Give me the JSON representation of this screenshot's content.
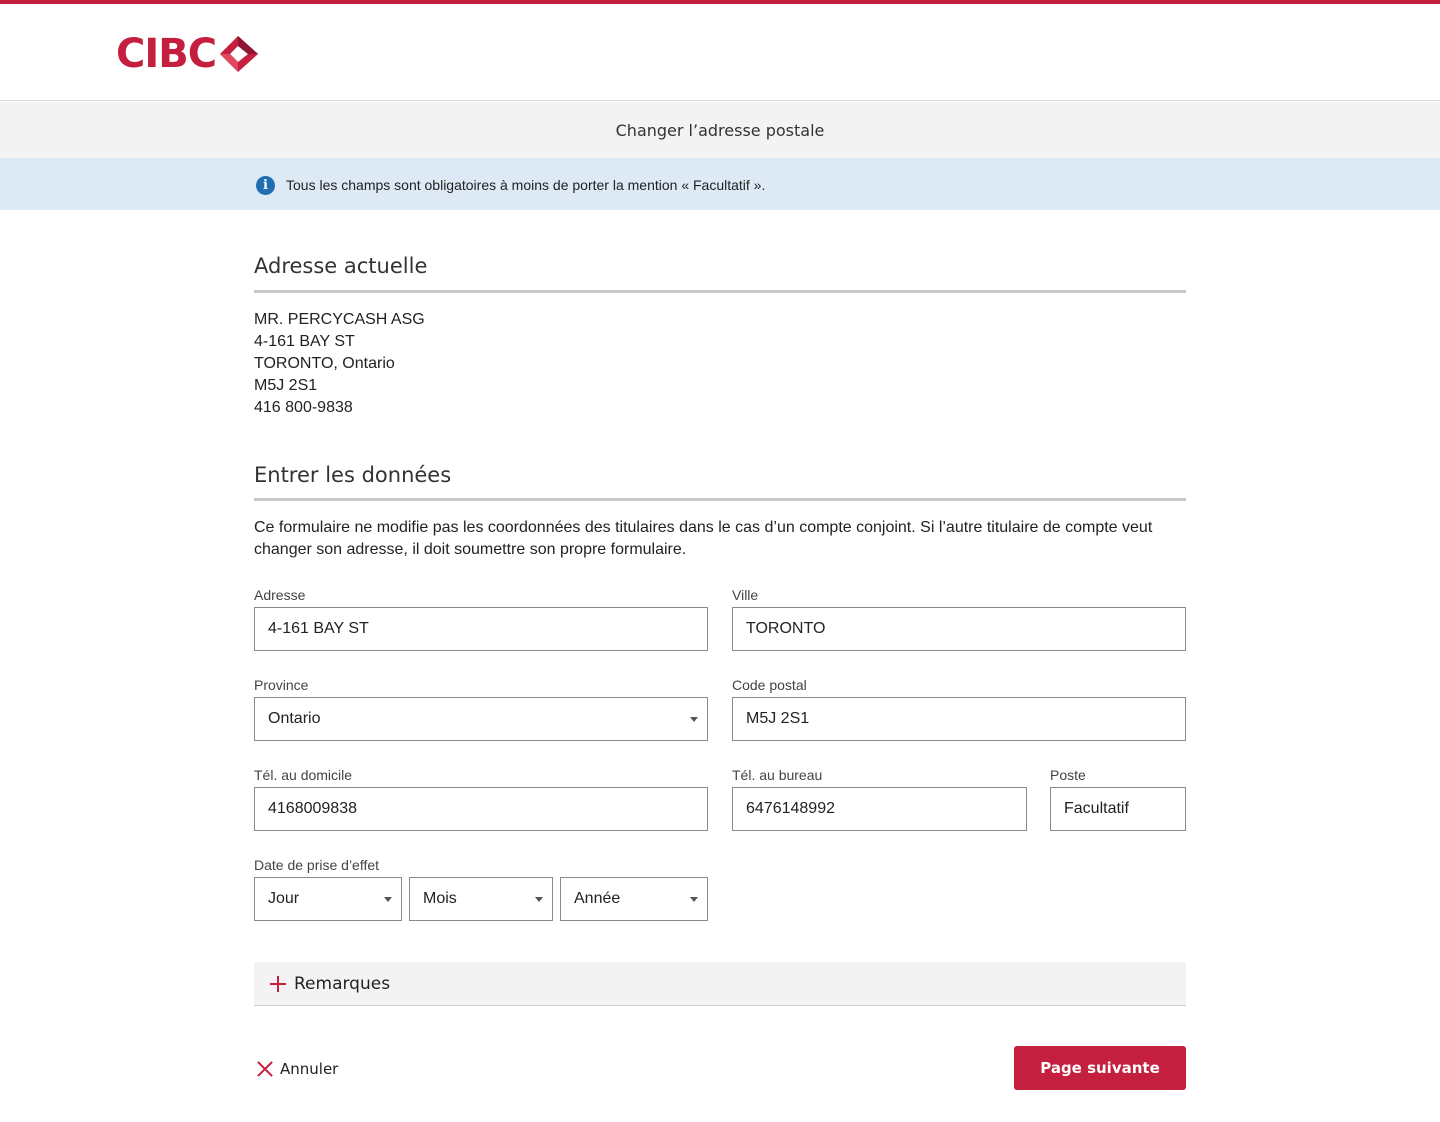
{
  "brand": {
    "name": "CIBC",
    "color": "#c41f3e"
  },
  "page": {
    "title": "Changer l’adresse postale"
  },
  "info": {
    "icon": "info-icon",
    "text": "Tous les champs sont obligatoires à moins de porter la mention « Facultatif »."
  },
  "current_address": {
    "heading": "Adresse actuelle",
    "lines": [
      "MR. PERCYCASH ASG",
      "4-161 BAY ST",
      "TORONTO, Ontario",
      "M5J 2S1",
      "416 800-9838"
    ]
  },
  "entry": {
    "heading": "Entrer les données",
    "note": "Ce formulaire ne modifie pas les coordonnées des titulaires dans le cas d’un compte conjoint. Si l’autre titulaire de compte veut changer son adresse, il doit soumettre son propre formulaire."
  },
  "form": {
    "address": {
      "label": "Adresse",
      "value": "4-161 BAY ST"
    },
    "city": {
      "label": "Ville",
      "value": "TORONTO"
    },
    "province": {
      "label": "Province",
      "selected": "Ontario"
    },
    "postal_code": {
      "label": "Code postal",
      "value": "M5J 2S1"
    },
    "home_phone": {
      "label": "Tél. au domicile",
      "value": "4168009838"
    },
    "work_phone": {
      "label": "Tél. au bureau",
      "value": "6476148992"
    },
    "extension": {
      "label": "Poste",
      "placeholder": "Facultatif"
    },
    "effective_date": {
      "label": "Date de prise d’effet",
      "day": "Jour",
      "month": "Mois",
      "year": "Année"
    }
  },
  "remarks": {
    "label": "Remarques"
  },
  "actions": {
    "cancel": "Annuler",
    "next": "Page suivante"
  }
}
